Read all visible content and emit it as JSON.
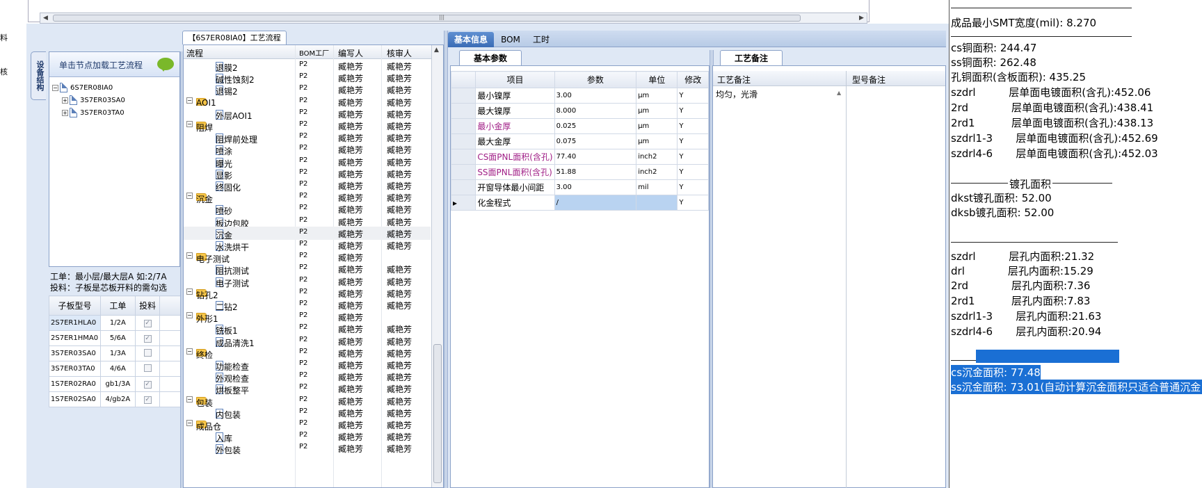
{
  "left_edge": [
    "料",
    "核"
  ],
  "tree": {
    "vtab": "设备结构",
    "header": "单击节点加载工艺流程",
    "root": "6S7ER08IA0",
    "children": [
      "3S7ER03SA0",
      "3S7ER03TA0"
    ]
  },
  "info": {
    "line1": "工单：最小层/最大层A 如:2/7A",
    "line2": "投料：子板是芯板开料的需勾选"
  },
  "sub_table": {
    "headers": [
      "子板型号",
      "工单",
      "投料"
    ],
    "rows": [
      {
        "model": "2S7ER1HLA0",
        "order": "1/2A",
        "checked": true
      },
      {
        "model": "2S7ER1HMA0",
        "order": "5/6A",
        "checked": true
      },
      {
        "model": "3S7ER03SA0",
        "order": "1/3A",
        "checked": false
      },
      {
        "model": "3S7ER03TA0",
        "order": "4/6A",
        "checked": false
      },
      {
        "model": "1S7ER02RA0",
        "order": "gb1/3A",
        "checked": true
      },
      {
        "model": "1S7ER02SA0",
        "order": "4/gb2A",
        "checked": true
      }
    ]
  },
  "flow": {
    "tab_title": "【6S7ER08IA0】工艺流程",
    "headers": [
      "流程",
      "BOM工厂",
      "编写人",
      "核审人"
    ],
    "rows": [
      {
        "name": "退膜2",
        "level": 1,
        "f": "P2",
        "w": "臧艳芳",
        "r": "臧艳芳"
      },
      {
        "name": "碱性蚀刻2",
        "level": 1,
        "f": "P2",
        "w": "臧艳芳",
        "r": "臧艳芳"
      },
      {
        "name": "退锡2",
        "level": 1,
        "f": "P2",
        "w": "臧艳芳",
        "r": "臧艳芳"
      },
      {
        "name": "AOI1",
        "level": 0,
        "f": "P2",
        "w": "臧艳芳",
        "r": "臧艳芳"
      },
      {
        "name": "外层AOI1",
        "level": 1,
        "f": "P2",
        "w": "臧艳芳",
        "r": "臧艳芳"
      },
      {
        "name": "阻焊",
        "level": 0,
        "f": "P2",
        "w": "臧艳芳",
        "r": "臧艳芳"
      },
      {
        "name": "阻焊前处理",
        "level": 1,
        "f": "P2",
        "w": "臧艳芳",
        "r": "臧艳芳"
      },
      {
        "name": "喷涂",
        "level": 1,
        "f": "P2",
        "w": "臧艳芳",
        "r": "臧艳芳"
      },
      {
        "name": "曝光",
        "level": 1,
        "f": "P2",
        "w": "臧艳芳",
        "r": "臧艳芳"
      },
      {
        "name": "显影",
        "level": 1,
        "f": "P2",
        "w": "臧艳芳",
        "r": "臧艳芳"
      },
      {
        "name": "终固化",
        "level": 1,
        "f": "P2",
        "w": "臧艳芳",
        "r": "臧艳芳"
      },
      {
        "name": "沉金",
        "level": 0,
        "f": "P2",
        "w": "臧艳芳",
        "r": "臧艳芳"
      },
      {
        "name": "喷砂",
        "level": 1,
        "f": "P2",
        "w": "臧艳芳",
        "r": "臧艳芳"
      },
      {
        "name": "板边包胶",
        "level": 1,
        "f": "P2",
        "w": "臧艳芳",
        "r": "臧艳芳"
      },
      {
        "name": "沉金",
        "level": 1,
        "f": "P2",
        "w": "臧艳芳",
        "r": "臧艳芳",
        "sel": true
      },
      {
        "name": "水洗烘干",
        "level": 1,
        "f": "P2",
        "w": "臧艳芳",
        "r": "臧艳芳"
      },
      {
        "name": "电子测试",
        "level": 0,
        "f": "P2",
        "w": "臧艳芳",
        "r": ""
      },
      {
        "name": "阻抗测试",
        "level": 1,
        "f": "P2",
        "w": "臧艳芳",
        "r": "臧艳芳"
      },
      {
        "name": "电子测试",
        "level": 1,
        "f": "P2",
        "w": "臧艳芳",
        "r": "臧艳芳"
      },
      {
        "name": "钻孔2",
        "level": 0,
        "f": "P2",
        "w": "臧艳芳",
        "r": "臧艳芳"
      },
      {
        "name": "二钻2",
        "level": 1,
        "f": "P2",
        "w": "臧艳芳",
        "r": "臧艳芳"
      },
      {
        "name": "外形1",
        "level": 0,
        "f": "P2",
        "w": "臧艳芳",
        "r": ""
      },
      {
        "name": "铣板1",
        "level": 1,
        "f": "P2",
        "w": "臧艳芳",
        "r": "臧艳芳"
      },
      {
        "name": "成品清洗1",
        "level": 1,
        "f": "P2",
        "w": "臧艳芳",
        "r": "臧艳芳"
      },
      {
        "name": "终检",
        "level": 0,
        "f": "P2",
        "w": "臧艳芳",
        "r": "臧艳芳"
      },
      {
        "name": "功能检查",
        "level": 1,
        "f": "P2",
        "w": "臧艳芳",
        "r": "臧艳芳"
      },
      {
        "name": "外观检查",
        "level": 1,
        "f": "P2",
        "w": "臧艳芳",
        "r": "臧艳芳"
      },
      {
        "name": "烘板整平",
        "level": 1,
        "f": "P2",
        "w": "臧艳芳",
        "r": "臧艳芳"
      },
      {
        "name": "包装",
        "level": 0,
        "f": "P2",
        "w": "臧艳芳",
        "r": "臧艳芳"
      },
      {
        "name": "内包装",
        "level": 1,
        "f": "P2",
        "w": "臧艳芳",
        "r": "臧艳芳"
      },
      {
        "name": "成品仓",
        "level": 0,
        "f": "P2",
        "w": "臧艳芳",
        "r": "臧艳芳"
      },
      {
        "name": "入库",
        "level": 1,
        "f": "P2",
        "w": "臧艳芳",
        "r": "臧艳芳"
      },
      {
        "name": "外包装",
        "level": 1,
        "f": "P2",
        "w": "臧艳芳",
        "r": "臧艳芳"
      }
    ]
  },
  "center_tabs": [
    "基本信息",
    "BOM",
    "工时"
  ],
  "basic_params": {
    "tab": "基本参数",
    "headers": [
      "项目",
      "参数",
      "单位",
      "修改"
    ],
    "rows": [
      {
        "item": "最小镍厚",
        "value": "3.00",
        "unit": "μm",
        "mod": "Y",
        "red": false
      },
      {
        "item": "最大镍厚",
        "value": "8.000",
        "unit": "μm",
        "mod": "Y",
        "red": false
      },
      {
        "item": "最小金厚",
        "value": "0.025",
        "unit": "μm",
        "mod": "Y",
        "red": true
      },
      {
        "item": "最大金厚",
        "value": "0.075",
        "unit": "μm",
        "mod": "Y",
        "red": false
      },
      {
        "item": "CS面PNL面积(含孔)",
        "value": "77.40",
        "unit": "inch2",
        "mod": "Y",
        "red": true
      },
      {
        "item": "SS面PNL面积(含孔)",
        "value": "51.88",
        "unit": "inch2",
        "mod": "Y",
        "red": true
      },
      {
        "item": "开窗导体最小间距",
        "value": "3.00",
        "unit": "mil",
        "mod": "Y",
        "red": false
      },
      {
        "item": "化金程式",
        "value": "/",
        "unit": "",
        "mod": "Y",
        "red": false,
        "current": true
      }
    ]
  },
  "notes": {
    "tab": "工艺备注",
    "col1": "工艺备注",
    "col2": "型号备注",
    "text": "均匀，光滑"
  },
  "right": {
    "smt": "成品最小SMT宽度(mil): 8.270",
    "areas": [
      "cs铜面积: 244.47",
      "ss铜面积: 262.48",
      "孔铜面积(含板面积): 435.25",
      "szdrl          层单面电镀面积(含孔):452.06",
      "2rd             层单面电镀面积(含孔):438.41",
      "2rd1           层单面电镀面积(含孔):438.13",
      "szdrl1-3       层单面电镀面积(含孔):452.69",
      "szdrl4-6       层单面电镀面积(含孔):452.03"
    ],
    "plated_title": "镀孔面积",
    "plated": [
      "dkst镀孔面积: 52.00",
      "dksb镀孔面积: 52.00"
    ],
    "inner": [
      "szdrl          层孔内面积:21.32",
      "drl             层孔内面积:15.29",
      "2rd             层孔内面积:7.36",
      "2rd1           层孔内面积:7.83",
      "szdrl1-3       层孔内面积:21.63",
      "szdrl4-6       层孔内面积:20.94"
    ],
    "gold": [
      "cs沉金面积: 77.48",
      "ss沉金面积: 73.01(自动计算沉金面积只适合普通沉金"
    ]
  }
}
